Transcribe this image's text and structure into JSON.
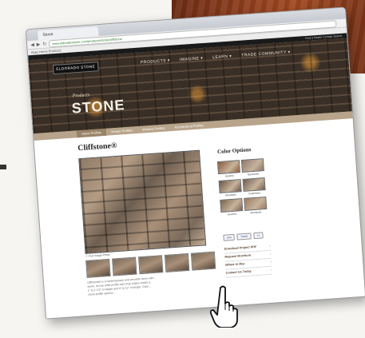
{
  "browser": {
    "tab_title": "Stone",
    "url": "www.eldoradostone.com/products/stone/cliffstone",
    "bookmarks": "Apps   Home   Products"
  },
  "site": {
    "top_links": "Find a Dealer   Contact   Search",
    "logo": "ELDORADO STONE",
    "nav": [
      "PRODUCTS ▾",
      "IMAGINE ▾",
      "LEARN ▾",
      "TRADE COMMUNITY ▾"
    ],
    "hero_subtitle": "Products",
    "hero_title": "STONE",
    "subtabs": [
      "Stone Profiles",
      "Veneer Profiles",
      "Window Profiles",
      "Architectural Profiles"
    ]
  },
  "product": {
    "title": "Cliffstone®",
    "photo_caption": "ⓘ Full Image Photo",
    "description": [
      "Cliffstone® is a contemporary and versatile stone with...",
      "stone. Its low relief profile and crisp edges create a...",
      "1\" to 1 1/2\" in height and 4\" to 12\" in length. Color...",
      "stone profile options..."
    ]
  },
  "color_options": {
    "heading": "Color Options",
    "swatches": [
      {
        "name": "Sedona",
        "color": "#8a5a3c"
      },
      {
        "name": "Nantucket",
        "color": "#8c7868"
      },
      {
        "name": "Mountain",
        "color": "#6b5646"
      },
      {
        "name": "Rushmore",
        "color": "#6e5e52"
      },
      {
        "name": "Sedona",
        "color": "#7a6450"
      },
      {
        "name": "Montecito",
        "color": "#9c7a60"
      }
    ]
  },
  "social": [
    "Like",
    "Tweet",
    "+1"
  ],
  "sidebar_links": [
    "Download Project PDF",
    "Request Brochure",
    "Where to Buy",
    "Contact Us Today"
  ]
}
